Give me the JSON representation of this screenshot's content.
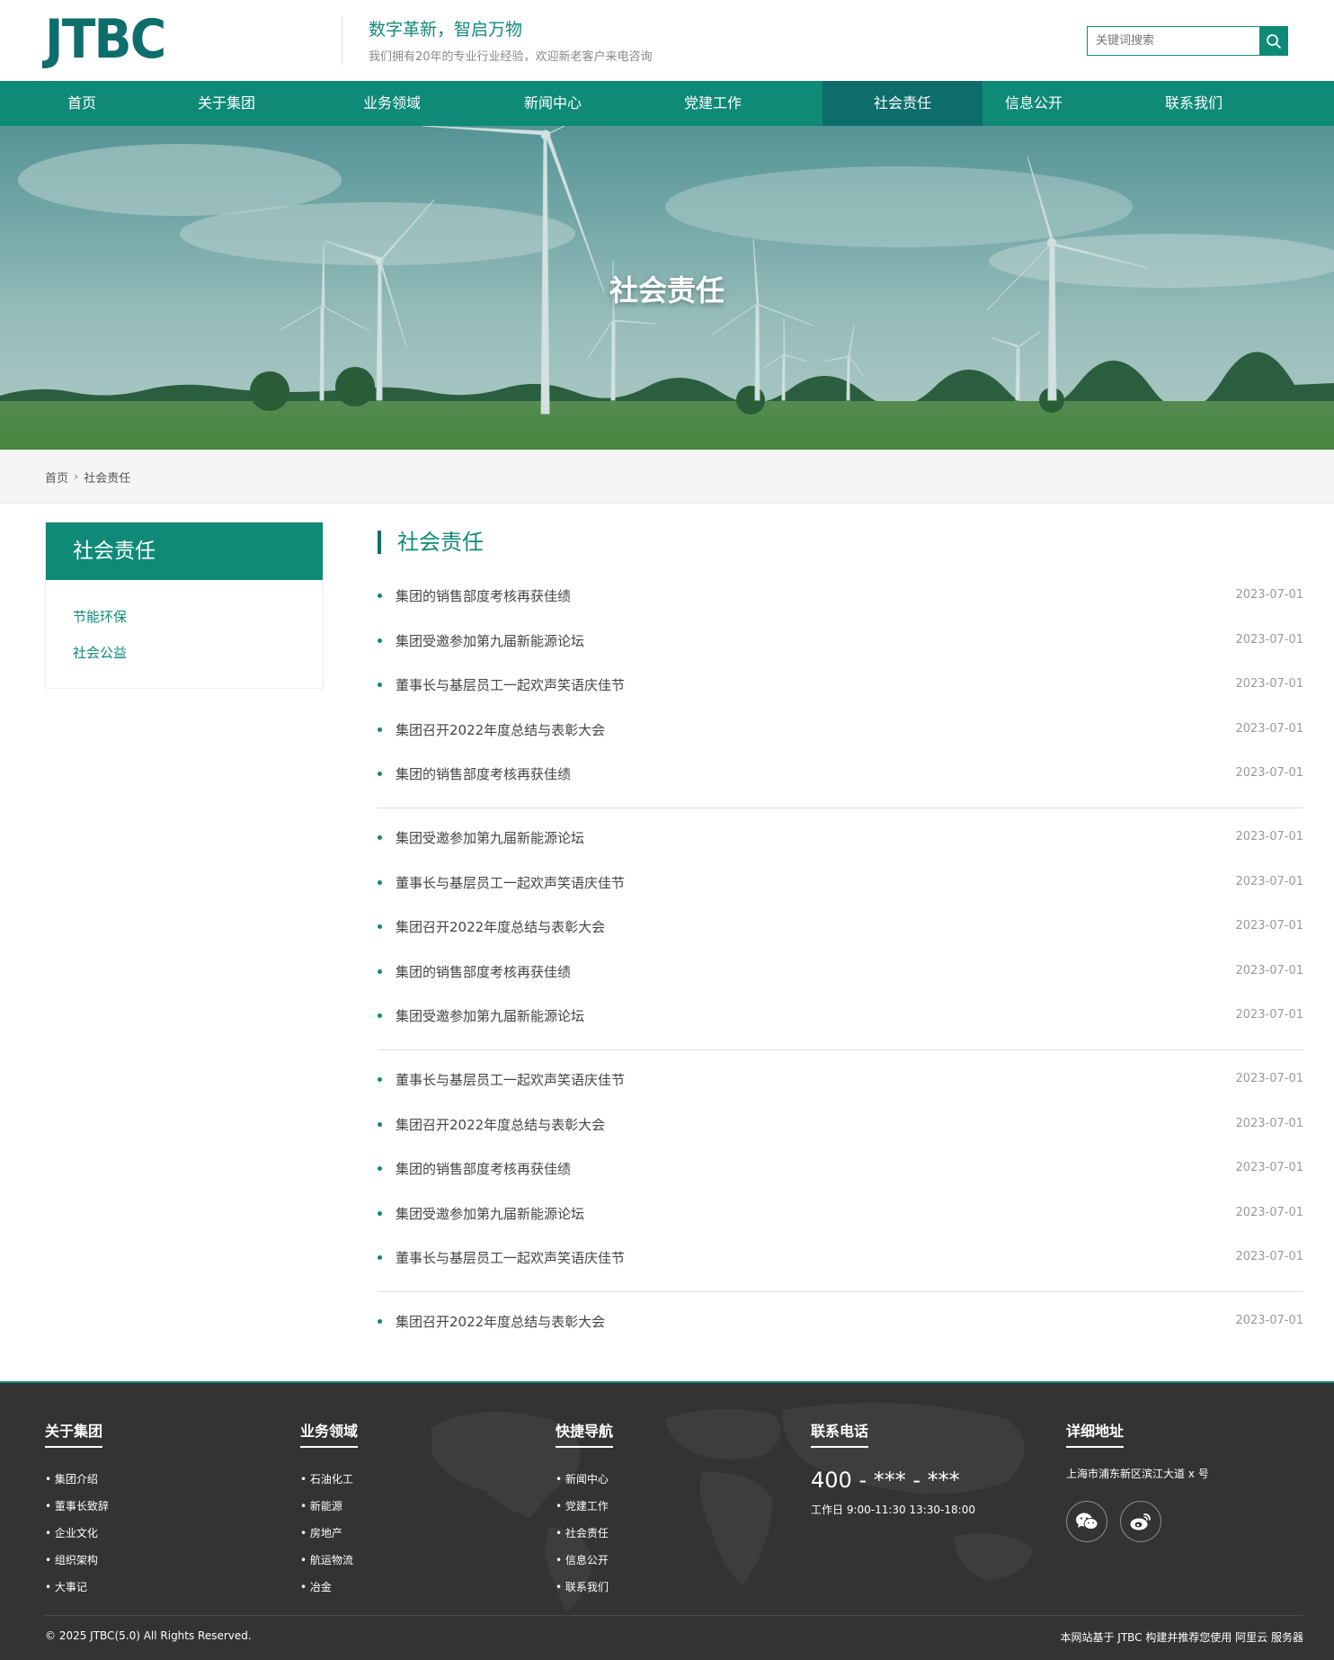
{
  "header": {
    "logo": "JTBC",
    "slogan": "数字革新，智启万物",
    "subslogan": "我们拥有20年的专业行业经验，欢迎新老客户来电咨询",
    "search_placeholder": "关键词搜索"
  },
  "nav": {
    "items": [
      "首页",
      "关于集团",
      "业务领域",
      "新闻中心",
      "党建工作",
      "社会责任",
      "信息公开",
      "联系我们"
    ],
    "active_index": 5
  },
  "banner": {
    "title": "社会责任"
  },
  "breadcrumb": {
    "home": "首页",
    "current": "社会责任"
  },
  "sidebar": {
    "title": "社会责任",
    "links": [
      "节能环保",
      "社会公益"
    ]
  },
  "main": {
    "title": "社会责任",
    "news": [
      {
        "title": "集团的销售部度考核再获佳绩",
        "date": "2023-07-01"
      },
      {
        "title": "集团受邀参加第九届新能源论坛",
        "date": "2023-07-01"
      },
      {
        "title": "董事长与基层员工一起欢声笑语庆佳节",
        "date": "2023-07-01"
      },
      {
        "title": "集团召开2022年度总结与表彰大会",
        "date": "2023-07-01"
      },
      {
        "title": "集团的销售部度考核再获佳绩",
        "date": "2023-07-01"
      },
      {
        "title": "集团受邀参加第九届新能源论坛",
        "date": "2023-07-01"
      },
      {
        "title": "董事长与基层员工一起欢声笑语庆佳节",
        "date": "2023-07-01"
      },
      {
        "title": "集团召开2022年度总结与表彰大会",
        "date": "2023-07-01"
      },
      {
        "title": "集团的销售部度考核再获佳绩",
        "date": "2023-07-01"
      },
      {
        "title": "集团受邀参加第九届新能源论坛",
        "date": "2023-07-01"
      },
      {
        "title": "董事长与基层员工一起欢声笑语庆佳节",
        "date": "2023-07-01"
      },
      {
        "title": "集团召开2022年度总结与表彰大会",
        "date": "2023-07-01"
      },
      {
        "title": "集团的销售部度考核再获佳绩",
        "date": "2023-07-01"
      },
      {
        "title": "集团受邀参加第九届新能源论坛",
        "date": "2023-07-01"
      },
      {
        "title": "董事长与基层员工一起欢声笑语庆佳节",
        "date": "2023-07-01"
      },
      {
        "title": "集团召开2022年度总结与表彰大会",
        "date": "2023-07-01"
      }
    ]
  },
  "footer": {
    "about": {
      "title": "关于集团",
      "links": [
        "集团介绍",
        "董事长致辞",
        "企业文化",
        "组织架构",
        "大事记"
      ]
    },
    "business": {
      "title": "业务领域",
      "links": [
        "石油化工",
        "新能源",
        "房地产",
        "航运物流",
        "冶金"
      ]
    },
    "quick": {
      "title": "快捷导航",
      "links": [
        "新闻中心",
        "党建工作",
        "社会责任",
        "信息公开",
        "联系我们"
      ]
    },
    "contact": {
      "title": "联系电话",
      "phone": "400 - *** - ***",
      "hours": "工作日 9:00-11:30 13:30-18:00"
    },
    "address": {
      "title": "详细地址",
      "text": "上海市浦东新区滨江大道 x 号"
    },
    "social_icons": [
      "wechat-icon",
      "weibo-icon"
    ],
    "copyright": "© 2025 JTBC(5.0) All Rights Reserved.",
    "powered": "本网站基于 JTBC 构建并推荐您使用 阿里云 服务器"
  },
  "colors": {
    "primary": "#0e8a77",
    "primary_dark": "#0d6d6a",
    "footer_bg": "#333333"
  }
}
